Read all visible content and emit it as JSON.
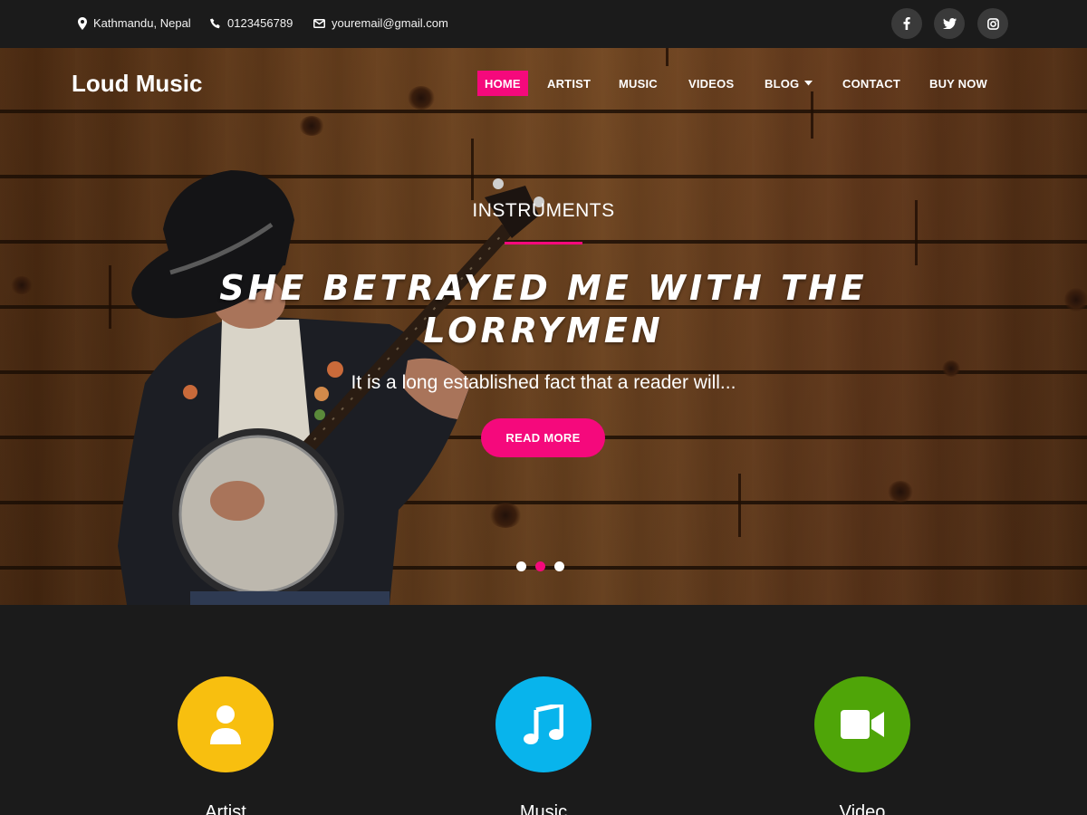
{
  "topbar": {
    "location": "Kathmandu, Nepal",
    "phone": "0123456789",
    "email": "youremail@gmail.com",
    "social": [
      {
        "icon": "facebook-icon",
        "glyph": "f"
      },
      {
        "icon": "twitter-icon"
      },
      {
        "icon": "instagram-icon"
      }
    ]
  },
  "header": {
    "logo": "Loud Music",
    "nav": [
      {
        "label": "HOME",
        "active": true
      },
      {
        "label": "ARTIST"
      },
      {
        "label": "MUSIC"
      },
      {
        "label": "VIDEOS"
      },
      {
        "label": "BLOG"
      },
      {
        "label": "CONTACT"
      },
      {
        "label": "BUY NOW"
      }
    ]
  },
  "hero": {
    "category": "INSTRUMENTS",
    "title": "She Betrayed Me With The Lorrymen",
    "text": "It is a long established fact that a reader will...",
    "button": "READ MORE",
    "slides": 3,
    "active_slide": 2
  },
  "features": [
    {
      "label": "Artist",
      "icon": "user-icon",
      "color": "#f8bf0f"
    },
    {
      "label": "Music",
      "icon": "music-note-icon",
      "color": "#08b4ec"
    },
    {
      "label": "Video",
      "icon": "video-camera-icon",
      "color": "#4fa508"
    }
  ],
  "colors": {
    "accent": "#f5097c",
    "dark": "#1b1b1b"
  }
}
